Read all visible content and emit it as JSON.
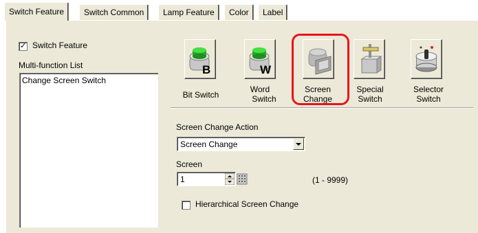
{
  "tabs": [
    {
      "label": "Switch Feature",
      "active": true
    },
    {
      "label": "Switch Common",
      "active": false
    },
    {
      "label": "Lamp Feature",
      "active": false
    },
    {
      "label": "Color",
      "active": false
    },
    {
      "label": "Label",
      "active": false
    }
  ],
  "left": {
    "switch_feature_checkbox": {
      "label": "Switch Feature",
      "checked": true
    },
    "multi_function_list_label": "Multi-function List",
    "list_items": [
      "Change Screen Switch"
    ]
  },
  "switch_types": [
    {
      "label_line1": "Bit Switch",
      "label_line2": "",
      "icon": "bit-switch-icon",
      "glyph": "B"
    },
    {
      "label_line1": "Word",
      "label_line2": "Switch",
      "icon": "word-switch-icon",
      "glyph": "W"
    },
    {
      "label_line1": "Screen",
      "label_line2": "Change",
      "icon": "screen-change-icon",
      "selected": true
    },
    {
      "label_line1": "Special",
      "label_line2": "Switch",
      "icon": "special-switch-icon"
    },
    {
      "label_line1": "Selector",
      "label_line2": "Switch",
      "icon": "selector-switch-icon"
    }
  ],
  "highlight_color": "#e8141c",
  "screen_change": {
    "action_label": "Screen Change Action",
    "action_value": "Screen Change",
    "screen_label": "Screen",
    "screen_value": "1",
    "range_text": "(1 - 9999)",
    "hierarchical_label": "Hierarchical Screen Change",
    "hierarchical_checked": false
  }
}
